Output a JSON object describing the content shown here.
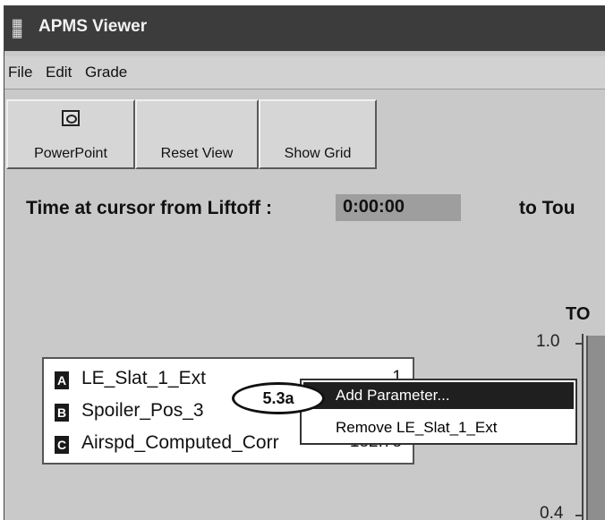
{
  "window": {
    "title": "APMS Viewer"
  },
  "menubar": {
    "items": [
      "File",
      "Edit",
      "Grade"
    ]
  },
  "toolbar": {
    "powerpoint_label": "PowerPoint",
    "reset_view_label": "Reset View",
    "show_grid_label": "Show Grid"
  },
  "time": {
    "label": "Time at cursor from Liftoff :",
    "value": "0:00:00",
    "to_label": "to Tou"
  },
  "chart": {
    "title": "TO",
    "ticks": [
      "1.0",
      "0.4"
    ]
  },
  "legend": {
    "items": [
      {
        "letter": "A",
        "name": "LE_Slat_1_Ext",
        "value": "1"
      },
      {
        "letter": "B",
        "name": "Spoiler_Pos_3",
        "value": ""
      },
      {
        "letter": "C",
        "name": "Airspd_Computed_Corr",
        "value": "182.78"
      }
    ]
  },
  "context_menu": {
    "items": [
      "Add Parameter...",
      "Remove LE_Slat_1_Ext"
    ],
    "selected_index": 0
  },
  "callout": {
    "text": "5.3a"
  },
  "colors": {
    "window_bg": "#c9c9c9",
    "titlebar": "#3c3c3c",
    "menu_highlight": "#1f1f1f"
  }
}
